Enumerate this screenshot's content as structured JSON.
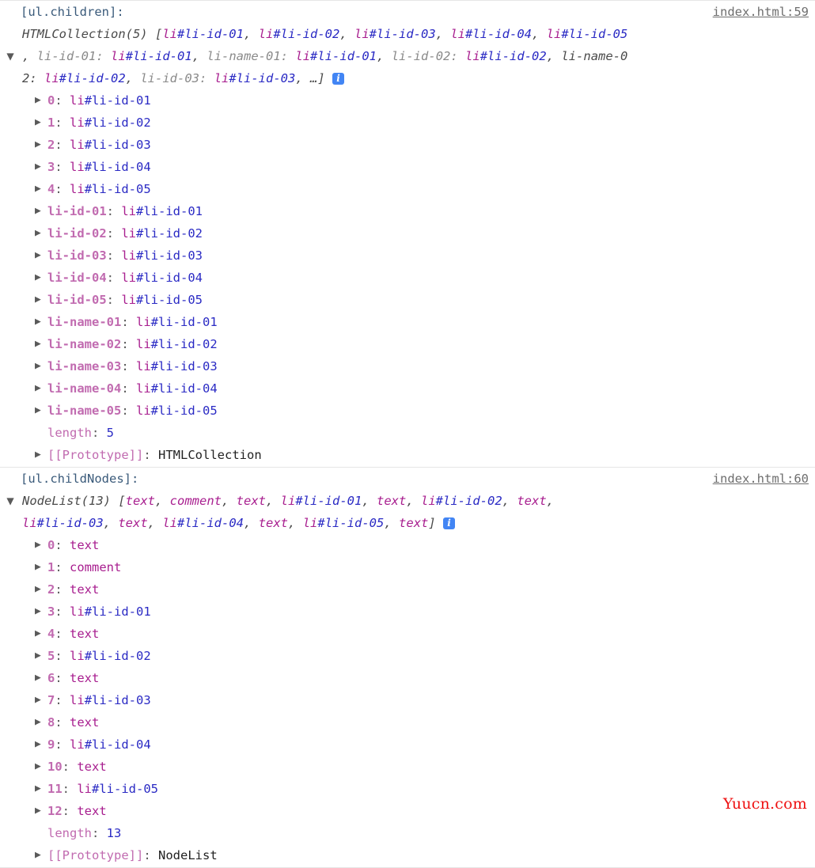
{
  "watermark": "Yuucn.com",
  "tokens": {
    "node_tag": "li",
    "ellipsis": "…",
    "info_glyph": "i",
    "arrow_collapsed": "▶",
    "arrow_expanded": "▼"
  },
  "groups": [
    {
      "id": "ul-children",
      "label": "[ul.children]:",
      "source_link": "index.html:59",
      "preview_lines": [
        "HTMLCollection(5) [li#li-id-01, li#li-id-02, li#li-id-03, li#li-id-04, li#li-id-05",
        ", li-id-01: li#li-id-01, li-name-01: li#li-id-01, li-id-02: li#li-id-02, li-name-0",
        "2: li#li-id-02, li-id-03: li#li-id-03, …]"
      ],
      "constructor_label": "HTMLCollection(5)",
      "rows": [
        {
          "key": "0",
          "key_kind": "index",
          "value": "li#li-id-01",
          "value_kind": "node",
          "expandable": true
        },
        {
          "key": "1",
          "key_kind": "index",
          "value": "li#li-id-02",
          "value_kind": "node",
          "expandable": true
        },
        {
          "key": "2",
          "key_kind": "index",
          "value": "li#li-id-03",
          "value_kind": "node",
          "expandable": true
        },
        {
          "key": "3",
          "key_kind": "index",
          "value": "li#li-id-04",
          "value_kind": "node",
          "expandable": true
        },
        {
          "key": "4",
          "key_kind": "index",
          "value": "li#li-id-05",
          "value_kind": "node",
          "expandable": true
        },
        {
          "key": "li-id-01",
          "key_kind": "name",
          "value": "li#li-id-01",
          "value_kind": "node",
          "expandable": true
        },
        {
          "key": "li-id-02",
          "key_kind": "name",
          "value": "li#li-id-02",
          "value_kind": "node",
          "expandable": true
        },
        {
          "key": "li-id-03",
          "key_kind": "name",
          "value": "li#li-id-03",
          "value_kind": "node",
          "expandable": true
        },
        {
          "key": "li-id-04",
          "key_kind": "name",
          "value": "li#li-id-04",
          "value_kind": "node",
          "expandable": true
        },
        {
          "key": "li-id-05",
          "key_kind": "name",
          "value": "li#li-id-05",
          "value_kind": "node",
          "expandable": true
        },
        {
          "key": "li-name-01",
          "key_kind": "name",
          "value": "li#li-id-01",
          "value_kind": "node",
          "expandable": true
        },
        {
          "key": "li-name-02",
          "key_kind": "name",
          "value": "li#li-id-02",
          "value_kind": "node",
          "expandable": true
        },
        {
          "key": "li-name-03",
          "key_kind": "name",
          "value": "li#li-id-03",
          "value_kind": "node",
          "expandable": true
        },
        {
          "key": "li-name-04",
          "key_kind": "name",
          "value": "li#li-id-04",
          "value_kind": "node",
          "expandable": true
        },
        {
          "key": "li-name-05",
          "key_kind": "name",
          "value": "li#li-id-05",
          "value_kind": "node",
          "expandable": true
        },
        {
          "key": "length",
          "key_kind": "plain",
          "value": "5",
          "value_kind": "number",
          "expandable": false
        },
        {
          "key": "[[Prototype]]",
          "key_kind": "proto",
          "value": "HTMLCollection",
          "value_kind": "proto",
          "expandable": true
        }
      ]
    },
    {
      "id": "ul-childnodes",
      "label": "[ul.childNodes]:",
      "source_link": "index.html:60",
      "preview_lines": [
        "NodeList(13) [text, comment, text, li#li-id-01, text, li#li-id-02, text,",
        "li#li-id-03, text, li#li-id-04, text, li#li-id-05, text]"
      ],
      "constructor_label": "NodeList(13)",
      "rows": [
        {
          "key": "0",
          "key_kind": "index",
          "value": "text",
          "value_kind": "plainnode",
          "expandable": true
        },
        {
          "key": "1",
          "key_kind": "index",
          "value": "comment",
          "value_kind": "plainnode",
          "expandable": true
        },
        {
          "key": "2",
          "key_kind": "index",
          "value": "text",
          "value_kind": "plainnode",
          "expandable": true
        },
        {
          "key": "3",
          "key_kind": "index",
          "value": "li#li-id-01",
          "value_kind": "node",
          "expandable": true
        },
        {
          "key": "4",
          "key_kind": "index",
          "value": "text",
          "value_kind": "plainnode",
          "expandable": true
        },
        {
          "key": "5",
          "key_kind": "index",
          "value": "li#li-id-02",
          "value_kind": "node",
          "expandable": true
        },
        {
          "key": "6",
          "key_kind": "index",
          "value": "text",
          "value_kind": "plainnode",
          "expandable": true
        },
        {
          "key": "7",
          "key_kind": "index",
          "value": "li#li-id-03",
          "value_kind": "node",
          "expandable": true
        },
        {
          "key": "8",
          "key_kind": "index",
          "value": "text",
          "value_kind": "plainnode",
          "expandable": true
        },
        {
          "key": "9",
          "key_kind": "index",
          "value": "li#li-id-04",
          "value_kind": "node",
          "expandable": true
        },
        {
          "key": "10",
          "key_kind": "index",
          "value": "text",
          "value_kind": "plainnode",
          "expandable": true
        },
        {
          "key": "11",
          "key_kind": "index",
          "value": "li#li-id-05",
          "value_kind": "node",
          "expandable": true
        },
        {
          "key": "12",
          "key_kind": "index",
          "value": "text",
          "value_kind": "plainnode",
          "expandable": true
        },
        {
          "key": "length",
          "key_kind": "plain",
          "value": "13",
          "value_kind": "number",
          "expandable": false
        },
        {
          "key": "[[Prototype]]",
          "key_kind": "proto",
          "value": "NodeList",
          "value_kind": "proto",
          "expandable": true
        }
      ]
    }
  ]
}
